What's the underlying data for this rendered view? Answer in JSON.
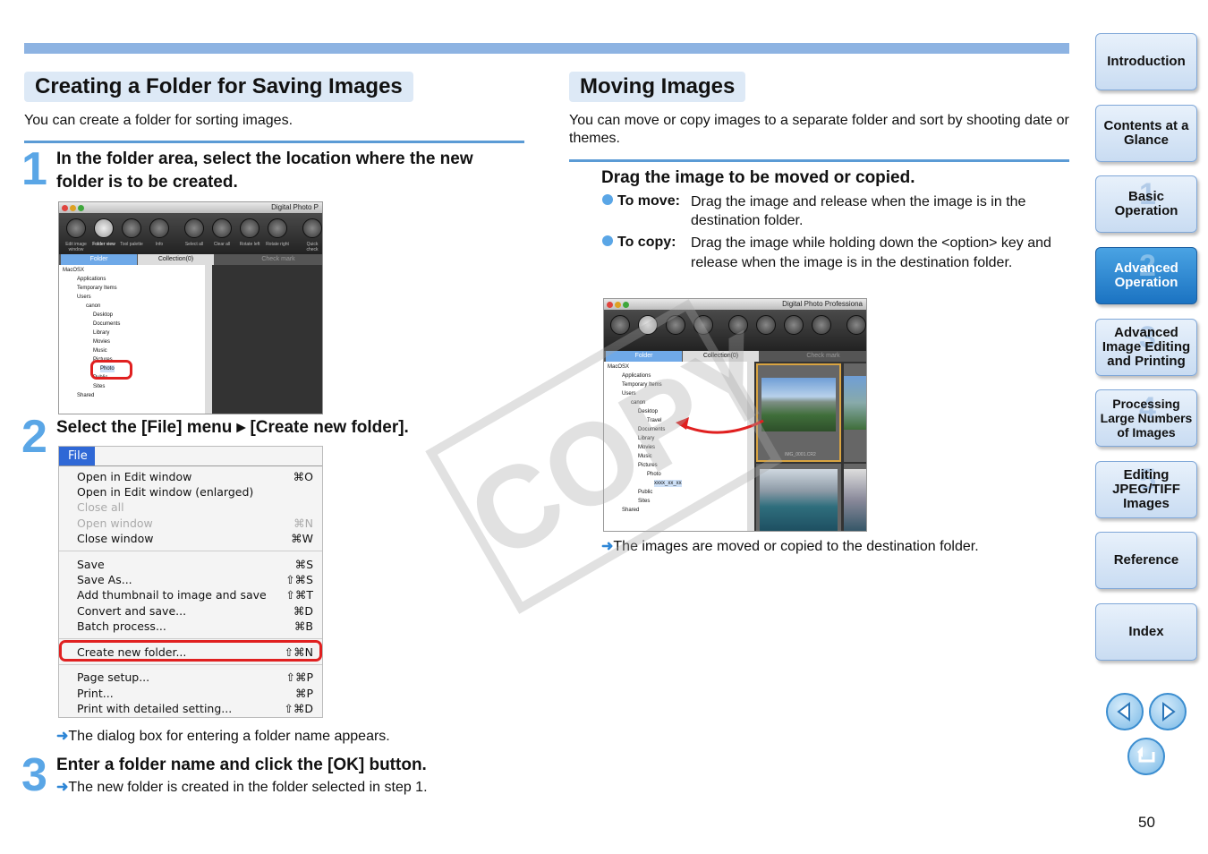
{
  "left": {
    "title": "Creating a Folder for Saving Images",
    "intro": "You can create a folder for sorting images.",
    "step1": {
      "num": "1",
      "text": "In the folder area, select the location where the new folder is to be created."
    },
    "step2": {
      "num": "2",
      "text": "Select the [File] menu ▸ [Create new folder]."
    },
    "step2_result": "The dialog box for entering a folder name appears.",
    "step3": {
      "num": "3",
      "text": "Enter a folder name and click the [OK] button."
    },
    "step3_result": "The new folder is created in the folder selected in step 1."
  },
  "right": {
    "title": "Moving Images",
    "intro": "You can move or copy images to a separate folder and sort by shooting date or themes.",
    "step_title": "Drag the image to be moved or copied.",
    "move_label": "To move:",
    "move_text": "Drag the image and release when the image is in the destination folder.",
    "copy_label": "To copy:",
    "copy_text": "Drag the image while holding down the <option> key and release when the image is in the destination folder.",
    "result": "The images are moved or copied to the destination folder."
  },
  "shot1": {
    "title": "Digital Photo P",
    "toolbar": [
      "Edit image window",
      "Folder view",
      "Tool palette",
      "Info",
      "Select all",
      "Clear all",
      "Rotate left",
      "Rotate right",
      "Quick check"
    ],
    "tab_folder": "Folder",
    "tab_collection": "Collection(0)",
    "checkmark": "Check mark",
    "tree": [
      "MacOSX",
      "Applications",
      "Temporary Items",
      "Users",
      "canon",
      "Desktop",
      "Documents",
      "Library",
      "Movies",
      "Music",
      "Pictures",
      "Photo",
      "Public",
      "Sites",
      "Shared"
    ]
  },
  "shot2": {
    "title": "Digital Photo Professiona",
    "tab_folder": "Folder",
    "tab_collection": "Collection(0)",
    "checkmark": "Check mark",
    "tree": [
      "MacOSX",
      "Applications",
      "Temporary Items",
      "Users",
      "canon",
      "Desktop",
      "Travel",
      "Documents",
      "Library",
      "Movies",
      "Music",
      "Pictures",
      "Photo",
      "xxxx_xx_xx",
      "Public",
      "Sites",
      "Shared"
    ],
    "thumb_label": "IMG_0001.CR2"
  },
  "menu": {
    "header": "File",
    "items": [
      {
        "label": "Open in Edit window",
        "sc": "⌘O"
      },
      {
        "label": "Open in Edit window (enlarged)",
        "sc": ""
      },
      {
        "label": "Close all",
        "sc": ""
      },
      {
        "label": "Open window",
        "sc": "⌘N"
      },
      {
        "label": "Close window",
        "sc": "⌘W"
      },
      {
        "label": "Save",
        "sc": "⌘S"
      },
      {
        "label": "Save As...",
        "sc": "⇧⌘S"
      },
      {
        "label": "Add thumbnail to image and save",
        "sc": "⇧⌘T"
      },
      {
        "label": "Convert and save...",
        "sc": "⌘D"
      },
      {
        "label": "Batch process...",
        "sc": "⌘B"
      },
      {
        "label": "Create new folder...",
        "sc": "⇧⌘N"
      },
      {
        "label": "Page setup...",
        "sc": "⇧⌘P"
      },
      {
        "label": "Print...",
        "sc": "⌘P"
      },
      {
        "label": "Print with detailed setting...",
        "sc": "⇧⌘D"
      }
    ]
  },
  "nav": [
    "Introduction",
    "Contents at a Glance",
    "Basic Operation",
    "Advanced Operation",
    "Advanced Image Editing and Printing",
    "Processing Large Numbers of Images",
    "Editing JPEG/TIFF Images",
    "Reference",
    "Index"
  ],
  "nav_nums": [
    "1",
    "2",
    "3",
    "4",
    "5"
  ],
  "watermark": "COPY",
  "page_number": "50",
  "colors": {
    "accent": "#5b9bd5",
    "nav_active": "#1b73c2",
    "highlight": "#e02020"
  }
}
